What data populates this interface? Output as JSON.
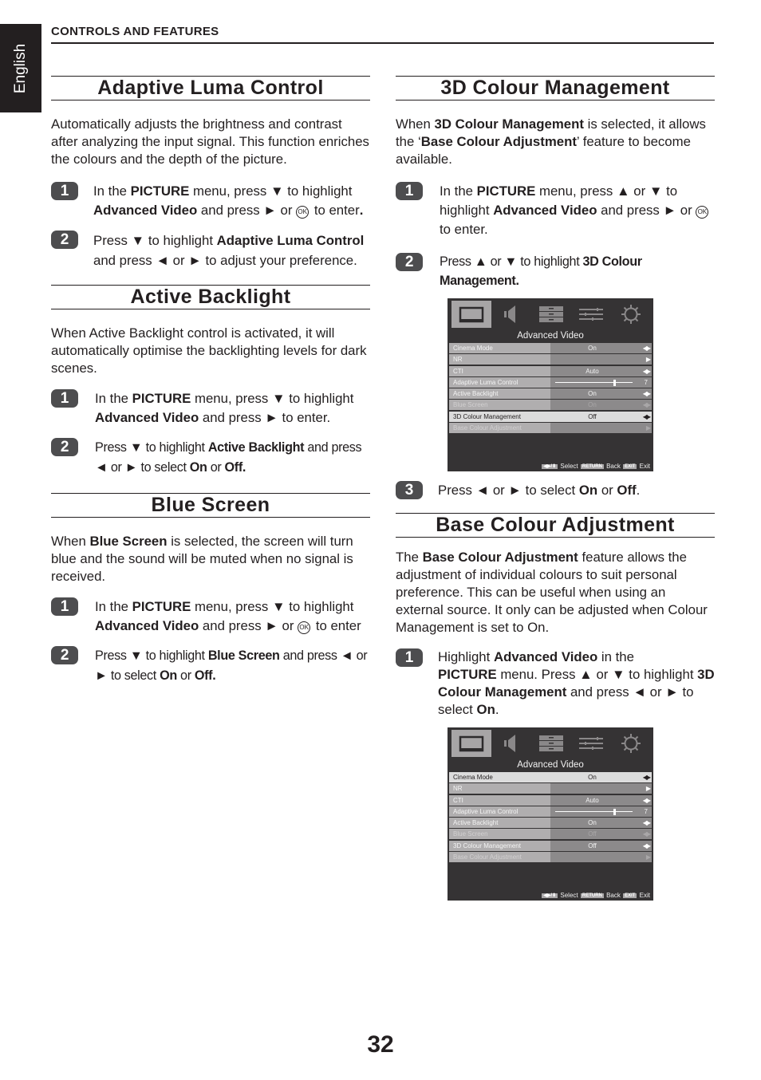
{
  "language_tab": "English",
  "header": "CONTROLS AND FEATURES",
  "page_number": "32",
  "sections": {
    "adaptive_luma": {
      "title": "Adaptive Luma Control",
      "intro": "Automatically adjusts the brightness and contrast after analyzing the input signal. This function enriches the colours and the depth of the picture.",
      "step1": {
        "num": "1",
        "t1": "In the ",
        "b1": "PICTURE",
        "t2": " menu, press ▼ to highlight ",
        "b2": "Advanced Video",
        "t3": " and press ► or ",
        "ok": "OK",
        "t4": " to enter",
        "b3": "."
      },
      "step2": {
        "num": "2",
        "t1": "Press ▼ to highlight ",
        "b1": "Adaptive Luma Control",
        "t2": " and press ◄ or ► to adjust your preference."
      }
    },
    "active_backlight": {
      "title": "Active Backlight",
      "intro": "When Active Backlight control is activated, it will automatically optimise the backlighting levels for dark scenes.",
      "step1": {
        "num": "1",
        "t1": "In the ",
        "b1": "PICTURE",
        "t2": " menu, press ▼ to highlight ",
        "b2": "Advanced Video",
        "t3": " and press ► to enter."
      },
      "step2": {
        "num": "2",
        "t1": "Press ▼ to highlight ",
        "b1": "Active Backlight",
        "t2": " and press ◄ or ► to select ",
        "b2": "On",
        "t3": " or ",
        "b3": "Off."
      }
    },
    "blue_screen": {
      "title": "Blue Screen",
      "intro_t1": "When ",
      "intro_b1": "Blue Screen",
      "intro_t2": " is selected, the screen will turn blue and the sound will be muted when no signal is received.",
      "step1": {
        "num": "1",
        "t1": "In the ",
        "b1": "PICTURE",
        "t2": " menu, press ▼ to highlight ",
        "b2": "Advanced Video",
        "t3": " and press ► or ",
        "ok": "OK",
        "t4": " to enter"
      },
      "step2": {
        "num": "2",
        "t1": "Press ▼ to highlight ",
        "b1": "Blue Screen",
        "t2": " and press ◄ or ► to select ",
        "b2": "On",
        "t3": " or ",
        "b3": "Off."
      }
    },
    "colour_3d": {
      "title": "3D Colour Management",
      "intro_t1": "When ",
      "intro_b1": "3D Colour Management",
      "intro_t2": " is selected, it allows the ‘",
      "intro_b2": "Base Colour Adjustment",
      "intro_t3": "’ feature to become available.",
      "step1": {
        "num": "1",
        "t1": "In the ",
        "b1": "PICTURE",
        "t2": " menu, press ▲ or ▼ to highlight ",
        "b2": "Advanced Video",
        "t3": " and press ► or ",
        "ok": "OK",
        "t4": " to enter."
      },
      "step2": {
        "num": "2",
        "t1": "Press ▲ or ▼ to highlight ",
        "b1": "3D Colour Management."
      },
      "step3": {
        "num": "3",
        "t1": "Press ◄ or ► to select ",
        "b1": "On",
        "t2": " or ",
        "b2": "Off",
        "t3": "."
      }
    },
    "base_colour": {
      "title": "Base Colour Adjustment",
      "intro_t1": "The ",
      "intro_b1": "Base Colour Adjustment",
      "intro_t2": " feature allows the adjustment of individual colours to suit personal preference. This can be useful when using an external source. It only can be adjusted when Colour Management is set to On.",
      "step1": {
        "num": "1",
        "t1": "Highlight ",
        "b1": "Advanced Video",
        "t2": " in the ",
        "b2": "PICTURE",
        "t3": " menu. Press ▲ or ▼ to highlight ",
        "b3": "3D Colour Management",
        "t4": " and press ◄ or ► to select ",
        "b4": "On",
        "t5": "."
      }
    }
  },
  "tv_menus": [
    {
      "tabs": [
        "picture-icon",
        "sound-icon",
        "setup-icon",
        "preferences-icon",
        "settings-icon"
      ],
      "active_tab": "picture-icon",
      "title": "Advanced Video",
      "rows": [
        {
          "label": "Cinema Mode",
          "value": "On",
          "arrows": "◀▶"
        },
        {
          "label": "NR",
          "value": "",
          "arrows": "▶"
        },
        {
          "label": "CTI",
          "value": "Auto",
          "arrows": "◀▶"
        },
        {
          "label": "Adaptive Luma Control",
          "value": "7",
          "slider_fraction": 0.75
        },
        {
          "label": "Active Backlight",
          "value": "On",
          "arrows": "◀▶"
        },
        {
          "label": "Blue Screen",
          "value": "On",
          "arrows": "◀▶",
          "dimmed": true
        },
        {
          "label": "3D Colour Management",
          "value": "Off",
          "arrows": "◀▶",
          "selected": true
        },
        {
          "label": "Base Colour Adjustment",
          "value": "",
          "arrows": "▶",
          "dimmed": true
        }
      ],
      "footer": {
        "select": "Select",
        "return_key": "RETURN",
        "back": "Back",
        "exit_key": "EXIT",
        "exit": "Exit"
      }
    },
    {
      "tabs": [
        "picture-icon",
        "sound-icon",
        "setup-icon",
        "preferences-icon",
        "settings-icon"
      ],
      "active_tab": "picture-icon",
      "title": "Advanced Video",
      "rows": [
        {
          "label": "Cinema Mode",
          "value": "On",
          "arrows": "◀▶",
          "selected": true
        },
        {
          "label": "NR",
          "value": "",
          "arrows": "▶"
        },
        {
          "label": "CTI",
          "value": "Auto",
          "arrows": "◀▶"
        },
        {
          "label": "Adaptive Luma Control",
          "value": "7",
          "slider_fraction": 0.75
        },
        {
          "label": "Active Backlight",
          "value": "On",
          "arrows": "◀▶"
        },
        {
          "label": "Blue Screen",
          "value": "Off",
          "arrows": "◀▶",
          "dimmed": true
        },
        {
          "label": "3D Colour Management",
          "value": "Off",
          "arrows": "◀▶"
        },
        {
          "label": "Base Colour Adjustment",
          "value": "",
          "arrows": "▶",
          "dimmed": true
        }
      ],
      "footer": {
        "select": "Select",
        "return_key": "RETURN",
        "back": "Back",
        "exit_key": "EXIT",
        "exit": "Exit"
      }
    }
  ]
}
